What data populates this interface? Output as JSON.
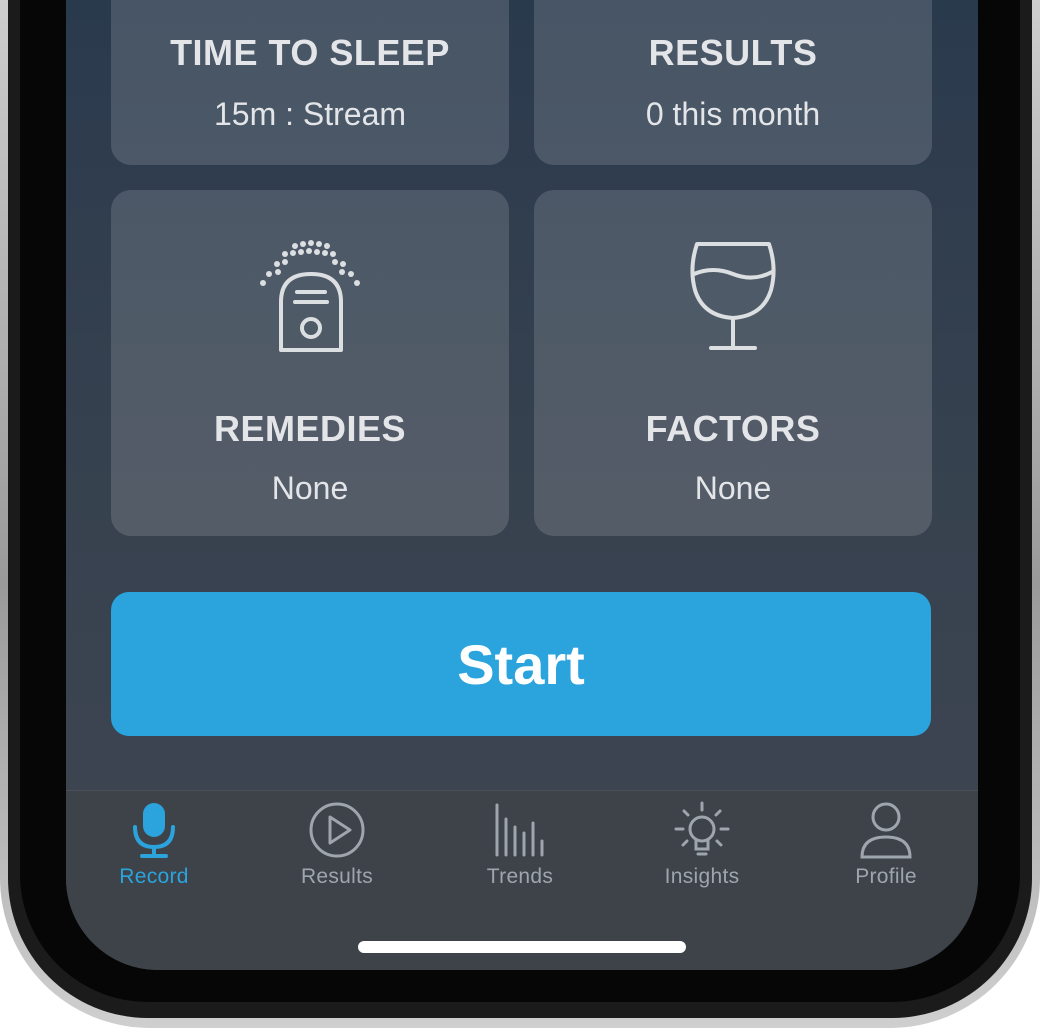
{
  "tiles": {
    "time_to_sleep": {
      "title": "TIME TO SLEEP",
      "value": "15m : Stream"
    },
    "results": {
      "title": "RESULTS",
      "value": "0 this month"
    },
    "remedies": {
      "title": "REMEDIES",
      "value": "None",
      "icon": "remedies-device-icon"
    },
    "factors": {
      "title": "FACTORS",
      "value": "None",
      "icon": "wine-glass-icon"
    }
  },
  "start_button": {
    "label": "Start"
  },
  "tabbar": {
    "active_tab": "Record",
    "items": [
      {
        "label": "Record",
        "icon": "microphone-icon"
      },
      {
        "label": "Results",
        "icon": "play-circle-icon"
      },
      {
        "label": "Trends",
        "icon": "bar-chart-icon"
      },
      {
        "label": "Insights",
        "icon": "lightbulb-icon"
      },
      {
        "label": "Profile",
        "icon": "person-icon"
      }
    ]
  },
  "colors": {
    "accent": "#2ba3dc",
    "tab_inactive": "#9ea5ad",
    "tile_text": "#e3e5e8"
  }
}
